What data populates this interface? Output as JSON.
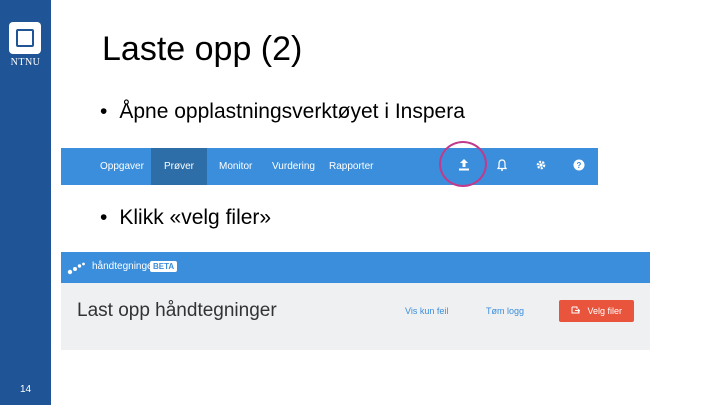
{
  "slide": {
    "logo_text": "NTNU",
    "title": "Laste opp (2)",
    "bullet_char": "•",
    "bullets": [
      "Åpne opplastningsverktøyet i Inspera",
      "Klikk «velg filer»"
    ],
    "page_number": "14"
  },
  "navbar": {
    "items": [
      "Oppgaver",
      "Prøver",
      "Monitor",
      "Vurdering",
      "Rapporter"
    ],
    "active_index": 1,
    "icons": [
      "upload-icon",
      "bell-icon",
      "gear-icon",
      "help-icon"
    ]
  },
  "upload_tool": {
    "header_title": "håndtegninger",
    "badge": "BETA",
    "heading": "Last opp håndtegninger",
    "show_errors_link": "Vis kun feil",
    "clear_log_link": "Tøm logg",
    "choose_files_button": "Velg filer"
  },
  "colors": {
    "ntnu_blue": "#1f5596",
    "inspera_blue": "#3b8edb",
    "active_tab": "#2e6ea8",
    "highlight": "#c13a8c",
    "button_red": "#e8543c"
  }
}
